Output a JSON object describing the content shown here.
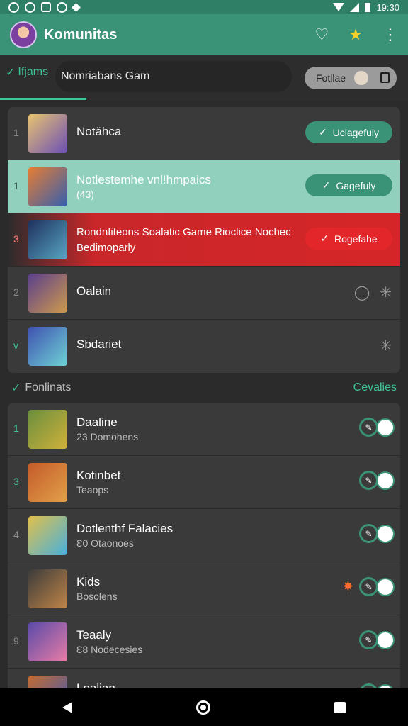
{
  "status_bar": {
    "time": "19:30"
  },
  "app_bar": {
    "title": "Komunitas"
  },
  "filter_bar": {
    "active_tab": "Ifjams",
    "field_value": "Nomriabans Gam",
    "chip_label": "Fotllae"
  },
  "top_list": [
    {
      "rank": "1",
      "title": "Notähca",
      "subtitle": "",
      "status": "Uclagefuly",
      "state": "normal",
      "thumb_colors": [
        "#e8c370",
        "#6b4fb5"
      ]
    },
    {
      "rank": "1",
      "title": "Notlestemhe vnl!hmpaics",
      "subtitle": "(43)",
      "status": "Gagefuly",
      "state": "highlight",
      "thumb_colors": [
        "#e67d33",
        "#345fb0"
      ]
    },
    {
      "rank": "3",
      "title": "Rondnfiteons Soalatic Game Rioclice Nochec",
      "subtitle": "Bedimoparly",
      "status": "Rogefahe",
      "state": "danger",
      "thumb_colors": [
        "#1e315e",
        "#59a6c4"
      ]
    },
    {
      "rank": "2",
      "title": "Oalain",
      "subtitle": "",
      "status": "",
      "state": "plain",
      "thumb_colors": [
        "#5a3f8c",
        "#cf9a4c"
      ]
    },
    {
      "rank": "v",
      "title": "Sbdariet",
      "subtitle": "",
      "status": "",
      "state": "plain",
      "thumb_colors": [
        "#3f52b0",
        "#6fd2d6"
      ]
    }
  ],
  "section": {
    "title": "Fonlinats",
    "link": "Cevalies"
  },
  "bottom_list": [
    {
      "rank": "1",
      "title": "Daaline",
      "subtitle": "23 Domohens",
      "thumb_colors": [
        "#6a8f3d",
        "#d0b13c"
      ]
    },
    {
      "rank": "3",
      "title": "Kotinbet",
      "subtitle": "Teaops",
      "thumb_colors": [
        "#c45b2a",
        "#e2a14a"
      ]
    },
    {
      "rank": "4",
      "title": "Dotlenthf Falacies",
      "subtitle": "Ɛ0 Otaonoes",
      "thumb_colors": [
        "#e1c04b",
        "#47b0de"
      ]
    },
    {
      "rank": "",
      "title": "Kids",
      "subtitle": "Bosolens",
      "thumb_colors": [
        "#3b3b3b",
        "#c18548"
      ]
    },
    {
      "rank": "9",
      "title": "Teaaly",
      "subtitle": "Ɛ8 Nodecesies",
      "thumb_colors": [
        "#5a4aa8",
        "#e87da6"
      ]
    },
    {
      "rank": "",
      "title": "Lealian",
      "subtitle": "",
      "thumb_colors": [
        "#c46b32",
        "#3e5bb0"
      ]
    }
  ]
}
